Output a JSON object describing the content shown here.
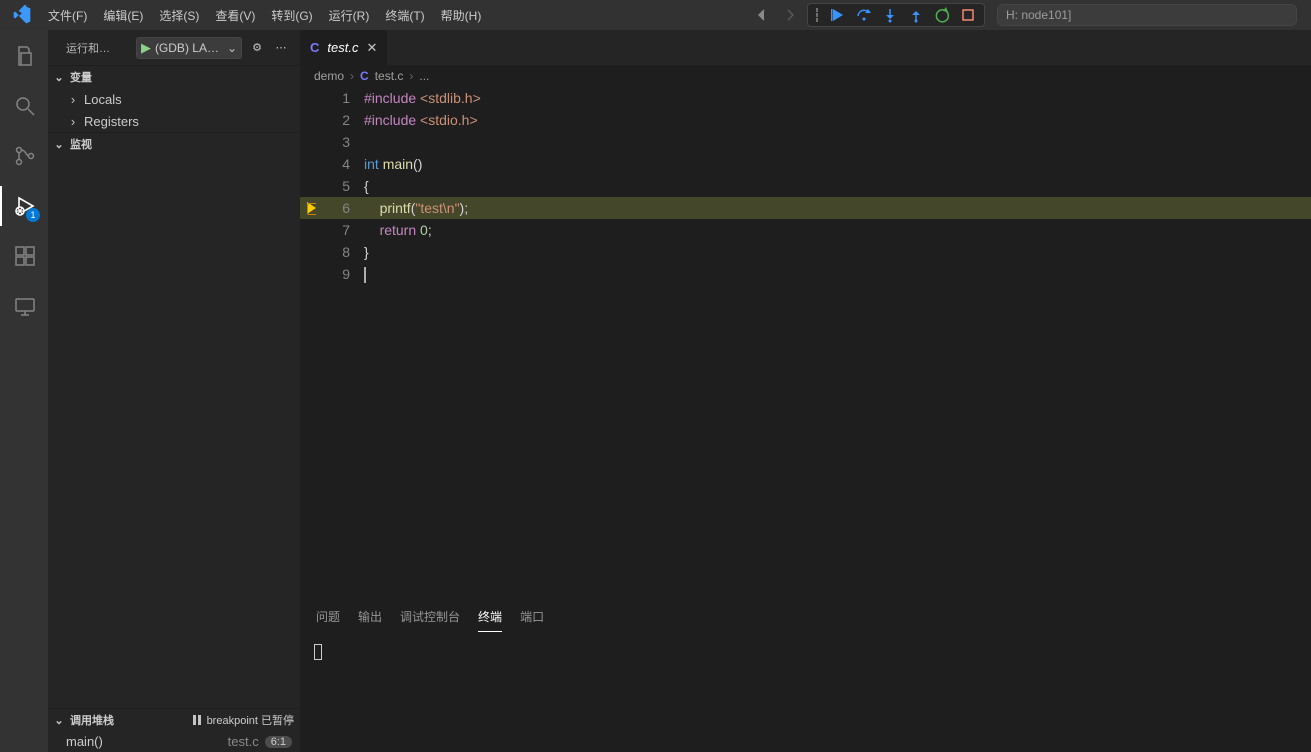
{
  "menu": {
    "items": [
      "文件(F)",
      "编辑(E)",
      "选择(S)",
      "查看(V)",
      "转到(G)",
      "运行(R)",
      "终端(T)",
      "帮助(H)"
    ]
  },
  "command_center": {
    "text": "H: node101]"
  },
  "activity": {
    "badge": "1"
  },
  "sidebar": {
    "title": "运行和…",
    "launch_config": "(gdb) laun",
    "sections": {
      "variables": {
        "label": "变量",
        "items": [
          "Locals",
          "Registers"
        ]
      },
      "watch": {
        "label": "监视"
      },
      "callstack": {
        "label": "调用堆栈",
        "badge": "breakpoint 已暂停",
        "frames": [
          {
            "fn": "main()",
            "file": "test.c",
            "line": "6:1"
          }
        ]
      }
    }
  },
  "tab": {
    "filename": "test.c",
    "lang": "C"
  },
  "breadcrumbs": [
    "demo",
    "test.c",
    "..."
  ],
  "breadcrumbs_lang": "C",
  "code": {
    "lines": [
      {
        "n": "1",
        "tokens": [
          {
            "c": "tok-pp",
            "t": "#include"
          },
          {
            "c": "",
            "t": " "
          },
          {
            "c": "tok-ang",
            "t": "<stdlib.h>"
          }
        ]
      },
      {
        "n": "2",
        "tokens": [
          {
            "c": "tok-pp",
            "t": "#include"
          },
          {
            "c": "",
            "t": " "
          },
          {
            "c": "tok-ang",
            "t": "<stdio.h>"
          }
        ]
      },
      {
        "n": "3",
        "tokens": []
      },
      {
        "n": "4",
        "tokens": [
          {
            "c": "tok-kw",
            "t": "int"
          },
          {
            "c": "",
            "t": " "
          },
          {
            "c": "tok-fn",
            "t": "main"
          },
          {
            "c": "tok-punc",
            "t": "()"
          }
        ]
      },
      {
        "n": "5",
        "tokens": [
          {
            "c": "tok-punc",
            "t": "{"
          }
        ]
      },
      {
        "n": "6",
        "hl": true,
        "bp": true,
        "tokens": [
          {
            "c": "",
            "t": "    "
          },
          {
            "c": "tok-fn",
            "t": "printf"
          },
          {
            "c": "tok-punc",
            "t": "("
          },
          {
            "c": "tok-str",
            "t": "\"test\\n\""
          },
          {
            "c": "tok-punc",
            "t": ");"
          }
        ]
      },
      {
        "n": "7",
        "tokens": [
          {
            "c": "",
            "t": "    "
          },
          {
            "c": "tok-pp",
            "t": "return"
          },
          {
            "c": "",
            "t": " "
          },
          {
            "c": "tok-num",
            "t": "0"
          },
          {
            "c": "tok-punc",
            "t": ";"
          }
        ]
      },
      {
        "n": "8",
        "tokens": [
          {
            "c": "tok-punc",
            "t": "}"
          }
        ]
      },
      {
        "n": "9",
        "cursor": true,
        "tokens": []
      }
    ]
  },
  "panel_tabs": [
    "问题",
    "输出",
    "调试控制台",
    "终端",
    "端口"
  ],
  "panel_active": 3
}
